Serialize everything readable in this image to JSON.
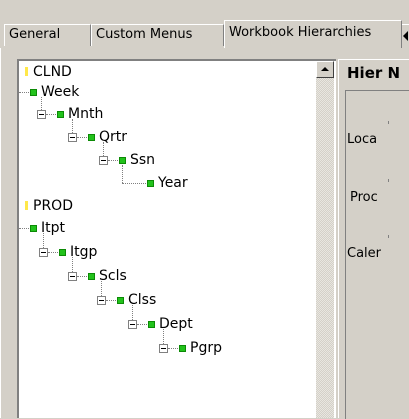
{
  "tabs": [
    {
      "label": "General",
      "active": false
    },
    {
      "label": "Custom Menus",
      "active": false
    },
    {
      "label": "Workbook Hierarchies",
      "active": true
    }
  ],
  "tree": {
    "roots": [
      {
        "label": "CLND",
        "children_path": [
          "Week",
          "Mnth",
          "Qrtr",
          "Ssn",
          "Year"
        ]
      },
      {
        "label": "PROD",
        "children_path": [
          "Itpt",
          "Itgp",
          "Scls",
          "Clss",
          "Dept",
          "Pgrp"
        ]
      }
    ]
  },
  "right_panel": {
    "title": "Hier N",
    "labels": [
      "Loca",
      "Proc",
      "Caler"
    ]
  },
  "colors": {
    "leaf_icon": "#22c21b",
    "root_marker": "#ffe84a",
    "face": "#d4d0c8"
  }
}
